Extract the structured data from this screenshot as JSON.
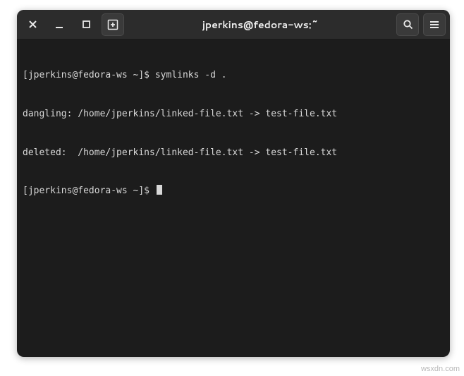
{
  "window": {
    "title": "jperkins@fedora-ws:~"
  },
  "terminal": {
    "lines": [
      {
        "prompt": "[jperkins@fedora-ws ~]$ ",
        "cmd": "symlinks -d ."
      },
      {
        "text": "dangling: /home/jperkins/linked-file.txt -> test-file.txt"
      },
      {
        "text": "deleted:  /home/jperkins/linked-file.txt -> test-file.txt"
      },
      {
        "prompt": "[jperkins@fedora-ws ~]$ ",
        "cmd": ""
      }
    ]
  },
  "watermark": "wsxdn.com"
}
